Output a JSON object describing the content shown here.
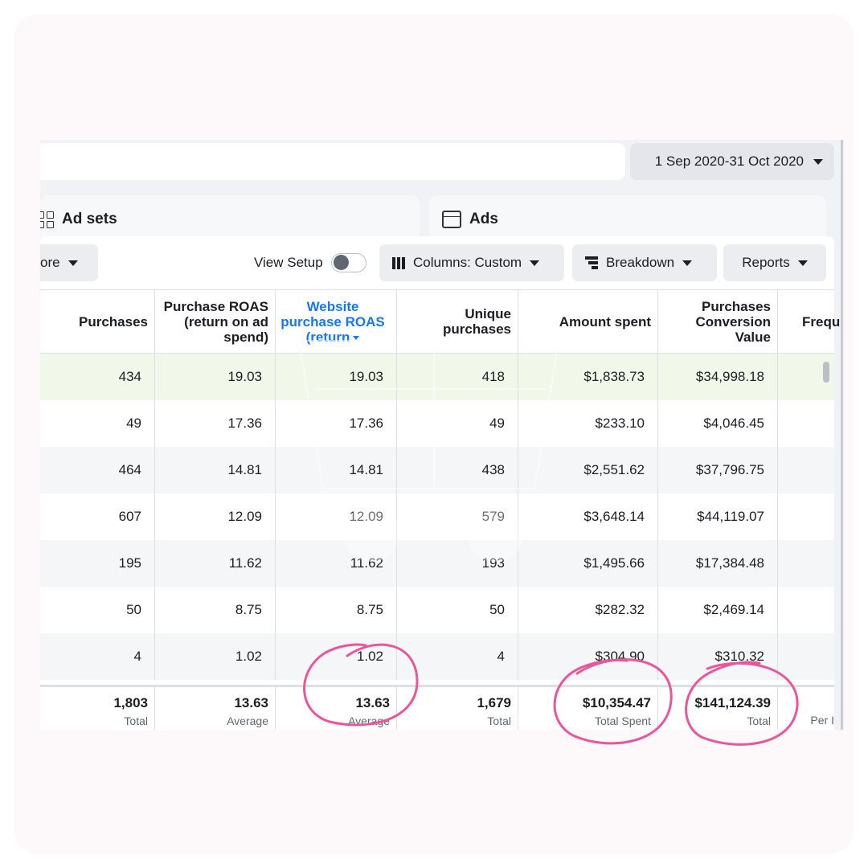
{
  "date_range": "1 Sep 2020-31 Oct 2020",
  "tabs": {
    "ad_sets": "Ad sets",
    "ads": "Ads"
  },
  "toolbar": {
    "more": "ore",
    "view_setup": "View Setup",
    "columns": "Columns: Custom",
    "breakdown": "Breakdown",
    "reports": "Reports"
  },
  "columns": [
    "Purchases",
    "Purchase ROAS (return on ad spend)",
    "Website purchase ROAS (return",
    "Unique purchases",
    "Amount spent",
    "Purchases Conversion Value",
    "Frequ"
  ],
  "rows": [
    [
      "434",
      "19.03",
      "19.03",
      "418",
      "$1,838.73",
      "$34,998.18"
    ],
    [
      "49",
      "17.36",
      "17.36",
      "49",
      "$233.10",
      "$4,046.45"
    ],
    [
      "464",
      "14.81",
      "14.81",
      "438",
      "$2,551.62",
      "$37,796.75"
    ],
    [
      "607",
      "12.09",
      "12.09",
      "579",
      "$3,648.14",
      "$44,119.07"
    ],
    [
      "195",
      "11.62",
      "11.62",
      "193",
      "$1,495.66",
      "$17,384.48"
    ],
    [
      "50",
      "8.75",
      "8.75",
      "50",
      "$282.32",
      "$2,469.14"
    ],
    [
      "4",
      "1.02",
      "1.02",
      "4",
      "$304.90",
      "$310.32"
    ]
  ],
  "totals": [
    {
      "value": "1,803",
      "label": "Total"
    },
    {
      "value": "13.63",
      "label": "Average"
    },
    {
      "value": "13.63",
      "label": "Average"
    },
    {
      "value": "1,679",
      "label": "Total"
    },
    {
      "value": "$10,354.47",
      "label": "Total Spent"
    },
    {
      "value": "$141,124.39",
      "label": "Total"
    },
    {
      "value": "",
      "label": "Per I"
    }
  ],
  "colors": {
    "highlight_circle": "#e8569b",
    "watermark": "#f9d7e6",
    "sorted_column": "#1877f2"
  }
}
